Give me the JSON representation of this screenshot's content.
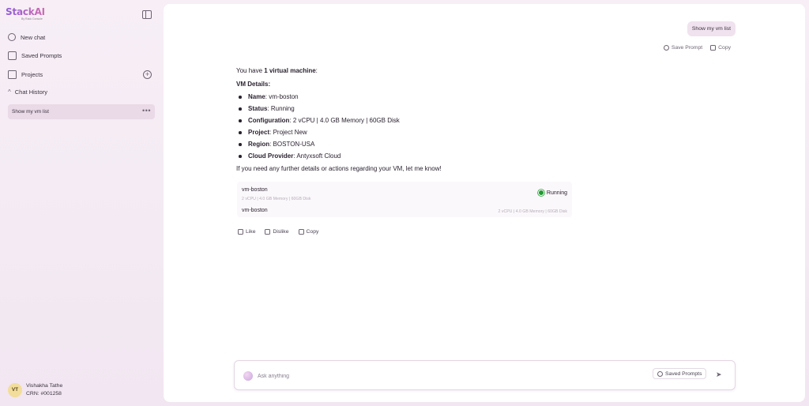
{
  "app": {
    "logo": "StackAI",
    "logo_sub": "By Rack Console"
  },
  "sidebar": {
    "items": [
      {
        "label": "New chat",
        "icon": "chat-icon"
      },
      {
        "label": "Saved Prompts",
        "icon": "bookmark-icon"
      },
      {
        "label": "Projects",
        "icon": "folder-icon"
      }
    ],
    "history_label": "Chat History",
    "history": [
      {
        "label": "Show my vm list"
      }
    ],
    "user": {
      "initials": "VT",
      "name": "Vishakha Tathe",
      "crn": "CRN: #001258"
    }
  },
  "chat": {
    "user_message": "Show my vm list",
    "save_prompt_label": "Save Prompt",
    "copy_label": "Copy",
    "answer": {
      "intro_prefix": "You have ",
      "intro_bold": "1 virtual machine",
      "intro_suffix": ":",
      "details_heading": "VM Details:",
      "details": [
        {
          "key": "Name",
          "value": ": vm-boston"
        },
        {
          "key": "Status",
          "value": ": Running"
        },
        {
          "key": "Configuration",
          "value": ": 2 vCPU | 4.0 GB Memory | 60GB Disk"
        },
        {
          "key": "Project",
          "value": ": Project New"
        },
        {
          "key": "Region",
          "value": ": BOSTON-USA"
        },
        {
          "key": "Cloud Provider",
          "value": ": Antyxsoft Cloud"
        }
      ],
      "closing": "If you need any further details or actions regarding your VM, let me know!"
    },
    "vm_card": {
      "rows": [
        {
          "name": "vm-boston",
          "spec": "2 vCPU | 4.0 GB Memory | 60GB Disk",
          "status": "Running"
        },
        {
          "name": "vm-boston",
          "spec": "2 vCPU | 4.0 GB Memory | 60GB Disk"
        }
      ],
      "status_color": "#1f9a2f"
    },
    "feedback": {
      "like": "Like",
      "dislike": "Dislike",
      "copy": "Copy"
    }
  },
  "composer": {
    "placeholder": "Ask anything",
    "value": "",
    "saved_prompts_label": "Saved Prompts"
  },
  "colors": {
    "accent": "#8e5cd9",
    "brand_pink": "#d06bb0",
    "bubble": "#f0e2ee"
  }
}
